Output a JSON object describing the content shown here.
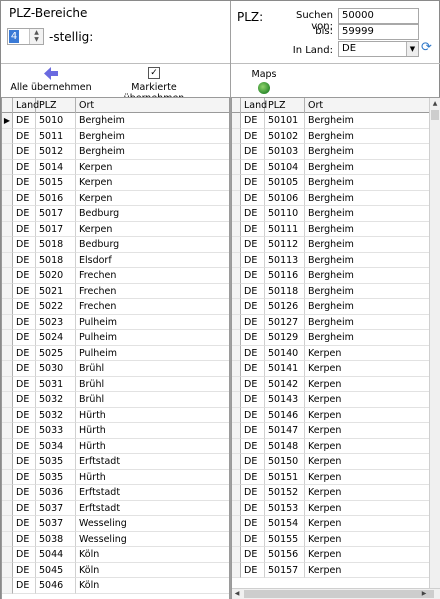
{
  "left_panel": {
    "title": "PLZ-Bereiche",
    "digits_value": "4",
    "digits_suffix": "-stellig:",
    "buttons": {
      "take_all": "Alle übernehmen",
      "take_marked": "Markierte übernehmen"
    },
    "grid": {
      "columns": [
        "Land",
        "PLZ",
        "Ort"
      ],
      "rows": [
        [
          "DE",
          "5010",
          "Bergheim"
        ],
        [
          "DE",
          "5011",
          "Bergheim"
        ],
        [
          "DE",
          "5012",
          "Bergheim"
        ],
        [
          "DE",
          "5014",
          "Kerpen"
        ],
        [
          "DE",
          "5015",
          "Kerpen"
        ],
        [
          "DE",
          "5016",
          "Kerpen"
        ],
        [
          "DE",
          "5017",
          "Bedburg"
        ],
        [
          "DE",
          "5017",
          "Kerpen"
        ],
        [
          "DE",
          "5018",
          "Bedburg"
        ],
        [
          "DE",
          "5018",
          "Elsdorf"
        ],
        [
          "DE",
          "5020",
          "Frechen"
        ],
        [
          "DE",
          "5021",
          "Frechen"
        ],
        [
          "DE",
          "5022",
          "Frechen"
        ],
        [
          "DE",
          "5023",
          "Pulheim"
        ],
        [
          "DE",
          "5024",
          "Pulheim"
        ],
        [
          "DE",
          "5025",
          "Pulheim"
        ],
        [
          "DE",
          "5030",
          "Brühl"
        ],
        [
          "DE",
          "5031",
          "Brühl"
        ],
        [
          "DE",
          "5032",
          "Brühl"
        ],
        [
          "DE",
          "5032",
          "Hürth"
        ],
        [
          "DE",
          "5033",
          "Hürth"
        ],
        [
          "DE",
          "5034",
          "Hürth"
        ],
        [
          "DE",
          "5035",
          "Erftstadt"
        ],
        [
          "DE",
          "5035",
          "Hürth"
        ],
        [
          "DE",
          "5036",
          "Erftstadt"
        ],
        [
          "DE",
          "5037",
          "Erftstadt"
        ],
        [
          "DE",
          "5037",
          "Wesseling"
        ],
        [
          "DE",
          "5038",
          "Wesseling"
        ],
        [
          "DE",
          "5044",
          "Köln"
        ],
        [
          "DE",
          "5045",
          "Köln"
        ],
        [
          "DE",
          "5046",
          "Köln"
        ]
      ]
    }
  },
  "right_panel": {
    "plz_label": "PLZ:",
    "search_from_label": "Suchen von:",
    "search_from_value": "50000",
    "to_label": "bis:",
    "to_value": "59999",
    "country_label": "In Land:",
    "country_value": "DE",
    "maps_label": "Maps",
    "grid": {
      "columns": [
        "Land",
        "PLZ",
        "Ort"
      ],
      "rows": [
        [
          "DE",
          "50101",
          "Bergheim"
        ],
        [
          "DE",
          "50102",
          "Bergheim"
        ],
        [
          "DE",
          "50103",
          "Bergheim"
        ],
        [
          "DE",
          "50104",
          "Bergheim"
        ],
        [
          "DE",
          "50105",
          "Bergheim"
        ],
        [
          "DE",
          "50106",
          "Bergheim"
        ],
        [
          "DE",
          "50110",
          "Bergheim"
        ],
        [
          "DE",
          "50111",
          "Bergheim"
        ],
        [
          "DE",
          "50112",
          "Bergheim"
        ],
        [
          "DE",
          "50113",
          "Bergheim"
        ],
        [
          "DE",
          "50116",
          "Bergheim"
        ],
        [
          "DE",
          "50118",
          "Bergheim"
        ],
        [
          "DE",
          "50126",
          "Bergheim"
        ],
        [
          "DE",
          "50127",
          "Bergheim"
        ],
        [
          "DE",
          "50129",
          "Bergheim"
        ],
        [
          "DE",
          "50140",
          "Kerpen"
        ],
        [
          "DE",
          "50141",
          "Kerpen"
        ],
        [
          "DE",
          "50142",
          "Kerpen"
        ],
        [
          "DE",
          "50143",
          "Kerpen"
        ],
        [
          "DE",
          "50146",
          "Kerpen"
        ],
        [
          "DE",
          "50147",
          "Kerpen"
        ],
        [
          "DE",
          "50148",
          "Kerpen"
        ],
        [
          "DE",
          "50150",
          "Kerpen"
        ],
        [
          "DE",
          "50151",
          "Kerpen"
        ],
        [
          "DE",
          "50152",
          "Kerpen"
        ],
        [
          "DE",
          "50153",
          "Kerpen"
        ],
        [
          "DE",
          "50154",
          "Kerpen"
        ],
        [
          "DE",
          "50155",
          "Kerpen"
        ],
        [
          "DE",
          "50156",
          "Kerpen"
        ],
        [
          "DE",
          "50157",
          "Kerpen"
        ]
      ]
    }
  },
  "icons": {
    "take_all": "arrow-left-icon",
    "take_marked": "checkbox-icon",
    "maps": "globe-icon",
    "refresh": "refresh-icon",
    "row_pointer": "row-pointer-icon"
  },
  "colors": {
    "selection": "#3a7ad6",
    "arrow": "#6a6ae0",
    "refresh": "#2f79c9"
  }
}
